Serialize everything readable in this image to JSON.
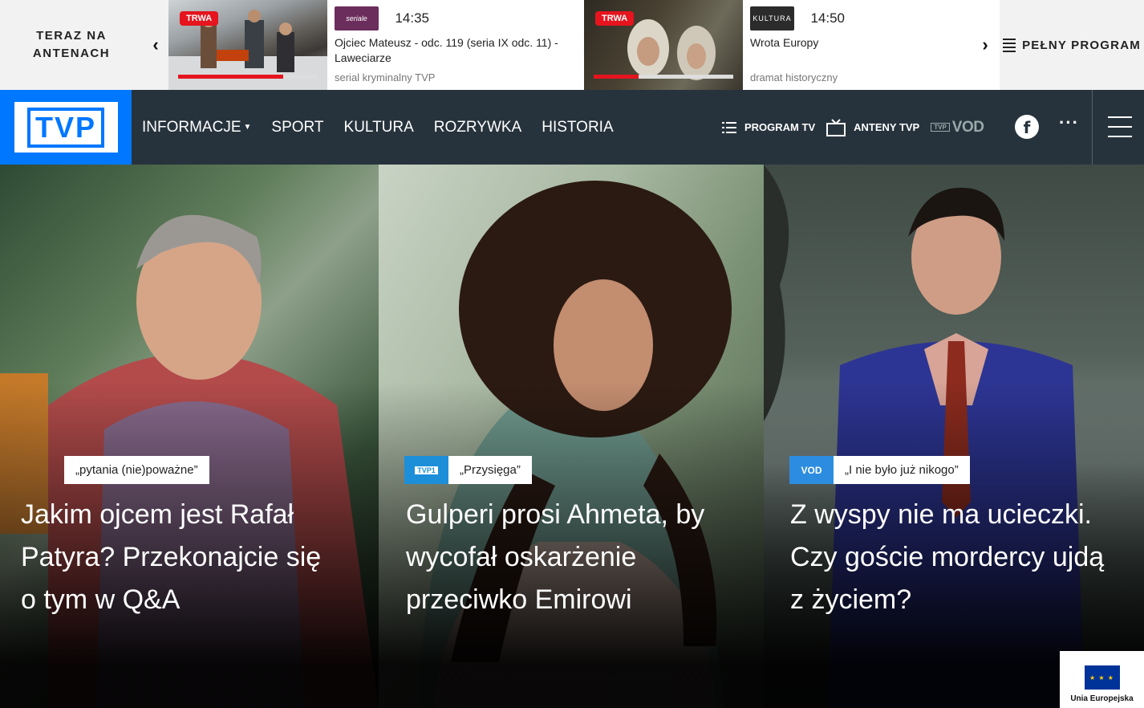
{
  "onair": {
    "label_line1": "TERAZ NA",
    "label_line2": "ANTENACH",
    "programs": [
      {
        "badge": "TRWA",
        "channel": "TVP seriale",
        "channel_logo_text": "seriale",
        "channel_color": "#6b2d5c",
        "time": "14:35",
        "title": "Ojciec Mateusz - odc. 119 (seria IX odc. 11) - Laweciarze",
        "genre": "serial kryminalny TVP",
        "progress": 0.75
      },
      {
        "badge": "TRWA",
        "channel": "TVP Kultura",
        "channel_logo_text": "KULTURA",
        "channel_color": "#2b2b2b",
        "time": "14:50",
        "title": "Wrota Europy",
        "genre": "dramat historyczny",
        "progress": 0.32
      }
    ],
    "full_program": "PEŁNY PROGRAM"
  },
  "nav": {
    "logo": "TVP",
    "menu": [
      "INFORMACJE",
      "SPORT",
      "KULTURA",
      "ROZRYWKA",
      "HISTORIA"
    ],
    "program_tv": "PROGRAM TV",
    "anteny": "ANTENY TVP",
    "vod_small": "TVP",
    "vod": "VOD",
    "more": "···"
  },
  "cards": [
    {
      "tag": "„pytania (nie)poważne”",
      "channel": "",
      "headline_lines": [
        "Jakim ojcem jest Rafał",
        "Patyra? Przekonajcie się",
        "o tym w Q&A"
      ]
    },
    {
      "tag": "„Przysięga”",
      "channel": "TVP1",
      "headline_lines": [
        "Gulperi prosi Ahmeta, by",
        "wycofał oskarżenie",
        "przeciwko Emirowi"
      ]
    },
    {
      "tag": "„I nie było już nikogo”",
      "channel": "VOD",
      "headline_lines": [
        "Z wyspy nie ma ucieczki.",
        "Czy goście mordercy ujdą",
        "z życiem?"
      ]
    }
  ],
  "eu": {
    "label": "Unia Europejska"
  },
  "colors": {
    "brand_blue": "#0077ff",
    "nav_bg": "#27333c",
    "live_red": "#e5141e"
  }
}
